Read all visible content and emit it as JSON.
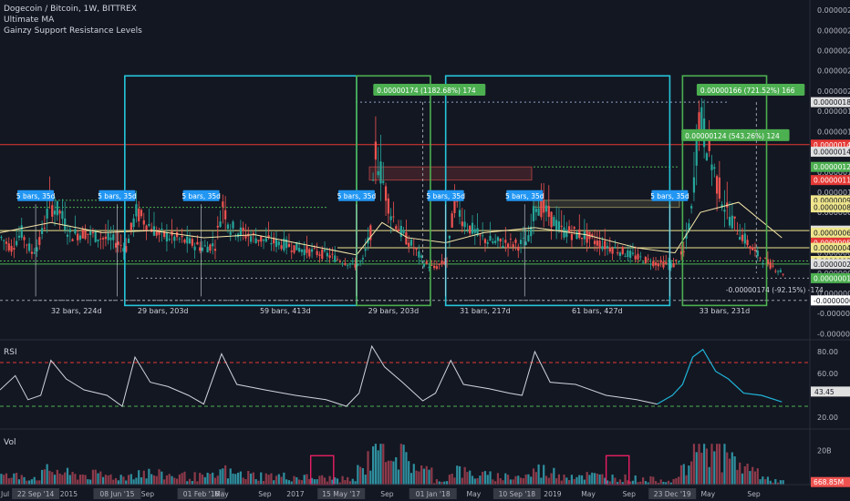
{
  "header": {
    "title": "Dogecoin / Bitcoin, 1W, BITTREX",
    "indicator_1": "Ultimate MA",
    "indicator_2": "Gainzy Support Resistance Levels"
  },
  "panes": {
    "rsi_label": "RSI",
    "vol_label": "Vol"
  },
  "colors": {
    "background": "#131722",
    "up": "#26a69a",
    "down": "#ef5350",
    "cyan_box": "#26c6da",
    "green_box": "#4caf50",
    "resistance": "#e53935",
    "support_yellow": "#f0e68c",
    "support_green": "#4caf50",
    "rsi_line": "#d1d4dc",
    "rsi_recent": "#1fb3d6",
    "vol_bar": "#2f8f9f",
    "pink_box": "#e91e63",
    "label_blue": "#2196f3",
    "label_green": "#4caf50"
  },
  "chart_data": [
    {
      "type": "candlestick",
      "title": "Dogecoin / Bitcoin, 1W, BITTREX",
      "x_ticks": [
        "Jul",
        "22 Sep '14",
        "2015",
        "08 Jun '15",
        "Sep",
        "01 Feb '16",
        "May",
        "Sep",
        "2017",
        "15 May '17",
        "Sep",
        "01 Jan '18",
        "May",
        "10 Sep '18",
        "2019",
        "May",
        "Sep",
        "23 Dec '19",
        "May",
        "Sep"
      ],
      "x_tick_highlight": [
        "22 Sep '14",
        "08 Jun '15",
        "01 Feb '16",
        "15 May '17",
        "01 Jan '18",
        "10 Sep '18",
        "23 Dec '19"
      ],
      "y_ticks": [
        "0.00000280",
        "0.00000260",
        "0.00000240",
        "0.00000220",
        "0.00000200",
        "0.00000180",
        "0.00000160",
        "0.00000140",
        "0.00000120",
        "0.00000100",
        "0.00000080",
        "0.00000060",
        "0.00000040",
        "0.00000020",
        "0.00000000",
        "-0.00000020",
        "-0.00000040"
      ],
      "ylim": [
        -4.5e-07,
        2.9e-06
      ],
      "price_labels": [
        {
          "text": "0.00000189",
          "value": 1.89e-06,
          "color": "#e0e0e0",
          "fg": "#131722"
        },
        {
          "text": "0.00000147",
          "value": 1.47e-06,
          "color": "#e53935",
          "fg": "#ffffff"
        },
        {
          "text": "0.00000140",
          "value": 1.4e-06,
          "color": "#e0e0e0",
          "fg": "#131722"
        },
        {
          "text": "0.00000125",
          "value": 1.25e-06,
          "color": "#4caf50",
          "fg": "#ffffff"
        },
        {
          "text": "0.00000112",
          "value": 1.12e-06,
          "color": "#e53935",
          "fg": "#ffffff"
        },
        {
          "text": "0.00000092",
          "value": 9.2e-07,
          "color": "#f0e68c",
          "fg": "#131722"
        },
        {
          "text": "0.00000085",
          "value": 8.5e-07,
          "color": "#f0e68c",
          "fg": "#131722"
        },
        {
          "text": "0.00000062",
          "value": 6.2e-07,
          "color": "#e0e0e0",
          "fg": "#131722"
        },
        {
          "text": "0.00000060",
          "value": 6e-07,
          "color": "#f0e68c",
          "fg": "#131722"
        },
        {
          "text": "0.00000050",
          "value": 5e-07,
          "color": "#e53935",
          "fg": "#ffffff"
        },
        {
          "text": "0.00000045",
          "value": 4.5e-07,
          "color": "#f0e68c",
          "fg": "#131722"
        },
        {
          "text": "0.00000032",
          "value": 3.2e-07,
          "color": "#f0e68c",
          "fg": "#131722"
        },
        {
          "text": "0.00000029",
          "value": 2.9e-07,
          "color": "#e0e0e0",
          "fg": "#131722"
        },
        {
          "text": "0.00000015",
          "value": 1.5e-07,
          "color": "#4caf50",
          "fg": "#ffffff"
        },
        {
          "text": "-0.00000007",
          "value": -7e-08,
          "color": "#ffffff",
          "fg": "#131722"
        }
      ],
      "range_labels": [
        "32 bars, 224d",
        "29 bars, 203d",
        "59 bars, 413d",
        "29 bars, 203d",
        "31 bars, 217d",
        "61 bars, 427d",
        "33 bars, 231d"
      ],
      "bar_labels": [
        "5 bars, 35d",
        "5 bars, 35d",
        "5 bars, 35d",
        "5 bars, 35d",
        "5 bars, 35d",
        "5 bars, 35d",
        "5 bars, 35d"
      ],
      "measure_labels": [
        {
          "text": "0.00000174 (1182.68%) 174",
          "color": "#4caf50"
        },
        {
          "text": "0.00000166 (721.52%) 166",
          "color": "#4caf50"
        },
        {
          "text": "0.00000124 (543.26%) 124",
          "color": "#4caf50"
        }
      ],
      "drop_label": "-0.00000174 (-92.15%) -174",
      "price_path": [
        [
          0,
          5.5e-07
        ],
        [
          4,
          4.5e-07
        ],
        [
          8,
          6e-07
        ],
        [
          12,
          4e-07
        ],
        [
          15,
          5e-07
        ],
        [
          19,
          8.8e-07
        ],
        [
          23,
          8e-07
        ],
        [
          27,
          5.8e-07
        ],
        [
          33,
          6e-07
        ],
        [
          39,
          5.5e-07
        ],
        [
          44,
          5.2e-07
        ],
        [
          49,
          4.5e-07
        ],
        [
          53,
          8e-07
        ],
        [
          57,
          7e-07
        ],
        [
          62,
          5.8e-07
        ],
        [
          68,
          5.5e-07
        ],
        [
          74,
          5e-07
        ],
        [
          79,
          4.5e-07
        ],
        [
          84,
          4.8e-07
        ],
        [
          87,
          8.8e-07
        ],
        [
          90,
          6.5e-07
        ],
        [
          96,
          5.8e-07
        ],
        [
          104,
          5.2e-07
        ],
        [
          112,
          4.8e-07
        ],
        [
          120,
          4.2e-07
        ],
        [
          128,
          3.8e-07
        ],
        [
          134,
          3.2e-07
        ],
        [
          139,
          2.8e-07
        ],
        [
          142,
          3.2e-07
        ],
        [
          145,
          6e-07
        ],
        [
          147,
          1.4e-06
        ],
        [
          150,
          1.1e-06
        ],
        [
          153,
          8e-07
        ],
        [
          157,
          6e-07
        ],
        [
          162,
          4.5e-07
        ],
        [
          166,
          3e-07
        ],
        [
          170,
          2.5e-07
        ],
        [
          175,
          3.2e-07
        ],
        [
          178,
          9e-07
        ],
        [
          182,
          7e-07
        ],
        [
          188,
          5.5e-07
        ],
        [
          194,
          5e-07
        ],
        [
          199,
          5e-07
        ],
        [
          203,
          4.8e-07
        ],
        [
          207,
          5.2e-07
        ],
        [
          210,
          9e-07
        ],
        [
          214,
          8e-07
        ],
        [
          220,
          6.2e-07
        ],
        [
          228,
          5.8e-07
        ],
        [
          236,
          4.8e-07
        ],
        [
          243,
          4.2e-07
        ],
        [
          250,
          3.5e-07
        ],
        [
          257,
          3e-07
        ],
        [
          264,
          2.8e-07
        ],
        [
          268,
          4e-07
        ],
        [
          271,
          8e-07
        ],
        [
          274,
          1.75e-06
        ],
        [
          277,
          1.5e-06
        ],
        [
          281,
          1.1e-06
        ],
        [
          285,
          8e-07
        ],
        [
          290,
          6e-07
        ],
        [
          296,
          4e-07
        ],
        [
          302,
          2.8e-07
        ],
        [
          307,
          2e-07
        ]
      ],
      "ma_line": [
        [
          0,
          6e-07
        ],
        [
          20,
          7e-07
        ],
        [
          40,
          6e-07
        ],
        [
          60,
          6.2e-07
        ],
        [
          80,
          5.5e-07
        ],
        [
          100,
          5.8e-07
        ],
        [
          120,
          4.8e-07
        ],
        [
          140,
          3.8e-07
        ],
        [
          150,
          7e-07
        ],
        [
          160,
          5.5e-07
        ],
        [
          175,
          5e-07
        ],
        [
          190,
          6e-07
        ],
        [
          210,
          6.5e-07
        ],
        [
          230,
          5.8e-07
        ],
        [
          250,
          4.5e-07
        ],
        [
          265,
          4e-07
        ],
        [
          275,
          8e-07
        ],
        [
          290,
          9e-07
        ],
        [
          307,
          5.5e-07
        ]
      ]
    },
    {
      "type": "line",
      "title": "RSI",
      "y_ticks": [
        "80.00",
        "60.00",
        "20.00"
      ],
      "current_label": "43.45",
      "ylim": [
        10,
        90
      ],
      "overbought": 70,
      "oversold": 30,
      "values": [
        [
          0,
          45
        ],
        [
          6,
          58
        ],
        [
          11,
          36
        ],
        [
          16,
          40
        ],
        [
          20,
          72
        ],
        [
          26,
          55
        ],
        [
          33,
          45
        ],
        [
          42,
          40
        ],
        [
          48,
          30
        ],
        [
          53,
          75
        ],
        [
          59,
          52
        ],
        [
          66,
          48
        ],
        [
          74,
          40
        ],
        [
          80,
          32
        ],
        [
          87,
          78
        ],
        [
          93,
          50
        ],
        [
          104,
          45
        ],
        [
          116,
          40
        ],
        [
          128,
          36
        ],
        [
          136,
          30
        ],
        [
          141,
          42
        ],
        [
          146,
          85
        ],
        [
          151,
          66
        ],
        [
          158,
          52
        ],
        [
          166,
          35
        ],
        [
          171,
          42
        ],
        [
          177,
          72
        ],
        [
          182,
          50
        ],
        [
          192,
          46
        ],
        [
          200,
          42
        ],
        [
          205,
          40
        ],
        [
          210,
          80
        ],
        [
          216,
          52
        ],
        [
          226,
          50
        ],
        [
          238,
          40
        ],
        [
          250,
          36
        ],
        [
          258,
          32
        ],
        [
          264,
          40
        ],
        [
          268,
          50
        ],
        [
          272,
          75
        ],
        [
          276,
          82
        ],
        [
          281,
          62
        ],
        [
          286,
          55
        ],
        [
          292,
          42
        ],
        [
          299,
          40
        ],
        [
          307,
          34
        ]
      ],
      "recent_start": 262
    },
    {
      "type": "bar",
      "title": "Vol",
      "y_ticks": [
        "20B"
      ],
      "current_label": "668.85M",
      "ylim": [
        0,
        30
      ]
    }
  ]
}
